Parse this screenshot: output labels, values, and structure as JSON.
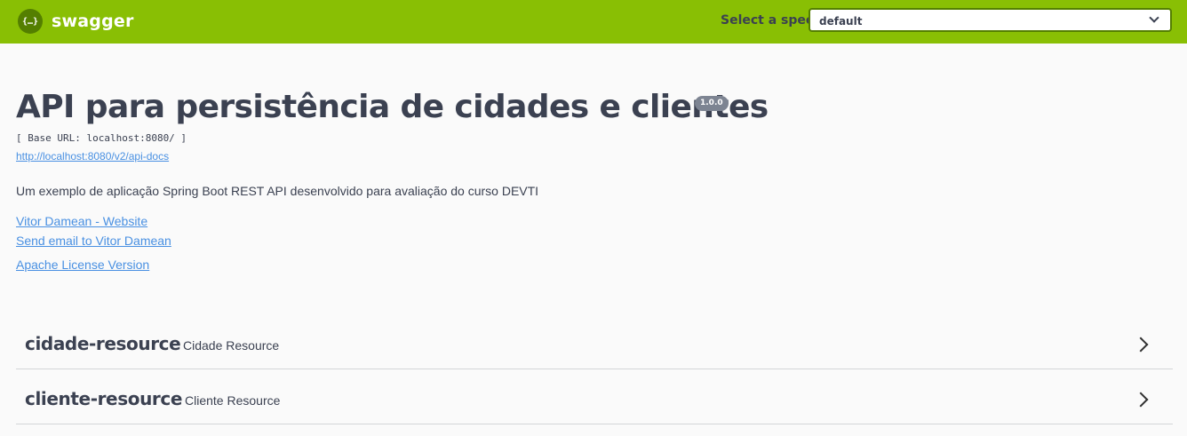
{
  "topbar": {
    "logo_symbol": "{…}",
    "logo_text": "swagger",
    "spec_label": "Select a spec",
    "spec_selected": "default",
    "color": "#89bf04"
  },
  "info": {
    "title": "API para persistência de cidades e clientes",
    "version": "1.0.0",
    "base_url": "[ Base URL: localhost:8080/ ]",
    "api_docs_url": "http://localhost:8080/v2/api-docs",
    "description": "Um exemplo de aplicação Spring Boot REST API desenvolvido para avaliação do curso DEVTI",
    "links": [
      {
        "label": "Vitor Damean - Website"
      },
      {
        "label": "Send email to Vitor Damean"
      },
      {
        "label": "Apache License Version"
      }
    ]
  },
  "tags": [
    {
      "name": "cidade-resource",
      "description": "Cidade Resource"
    },
    {
      "name": "cliente-resource",
      "description": "Cliente Resource"
    }
  ],
  "colors": {
    "link": "#4990e2",
    "text": "#3b4151",
    "version_badge": "#7d8492"
  }
}
